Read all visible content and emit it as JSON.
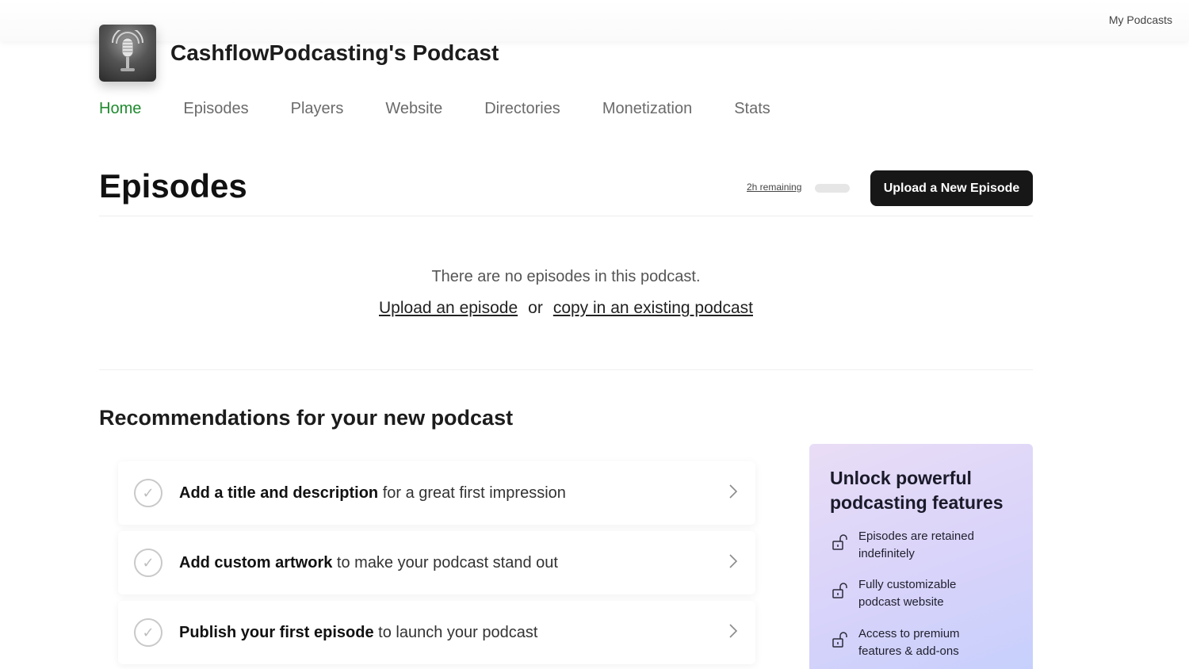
{
  "topbar": {
    "my_podcasts": "My Podcasts"
  },
  "podcast": {
    "title": "CashflowPodcasting's Podcast"
  },
  "nav": {
    "items": [
      {
        "label": "Home",
        "active": true
      },
      {
        "label": "Episodes",
        "active": false
      },
      {
        "label": "Players",
        "active": false
      },
      {
        "label": "Website",
        "active": false
      },
      {
        "label": "Directories",
        "active": false
      },
      {
        "label": "Monetization",
        "active": false
      },
      {
        "label": "Stats",
        "active": false
      }
    ]
  },
  "episodes": {
    "heading": "Episodes",
    "remaining": "2h remaining",
    "upload_button": "Upload a New Episode",
    "empty_message": "There are no episodes in this podcast.",
    "upload_link": "Upload an episode",
    "or_text": "or",
    "copy_link": "copy in an existing podcast"
  },
  "recommendations": {
    "heading": "Recommendations for your new podcast",
    "items": [
      {
        "bold": "Add a title and description",
        "rest": " for a great first impression"
      },
      {
        "bold": "Add custom artwork",
        "rest": " to make your podcast stand out"
      },
      {
        "bold": "Publish your first episode",
        "rest": " to launch your podcast"
      }
    ]
  },
  "upsell": {
    "title": "Unlock powerful podcasting features",
    "features": [
      "Episodes are retained indefinitely",
      "Fully customizable podcast website",
      "Access to premium features & add-ons"
    ]
  },
  "colors": {
    "accent_green": "#1f8a2e",
    "button_dark": "#171717",
    "upsell_gradient_start": "#e9ddf6",
    "upsell_gradient_end": "#c5cffc"
  },
  "icons": {
    "artwork": "microphone-icon",
    "check": "check-circle-icon",
    "chevron": "chevron-right-icon",
    "feature": "unlock-icon"
  }
}
